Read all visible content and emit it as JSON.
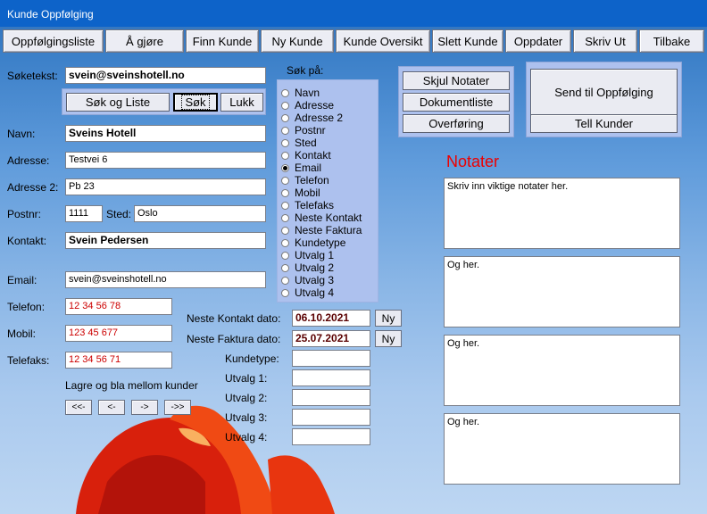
{
  "window": {
    "title": "Kunde Oppfølging"
  },
  "toolbar": [
    {
      "label": "Oppfølgingsliste"
    },
    {
      "label": "Å gjøre"
    },
    {
      "label": "Finn Kunde"
    },
    {
      "label": "Ny Kunde"
    },
    {
      "label": "Kunde Oversikt"
    },
    {
      "label": "Slett Kunde"
    },
    {
      "label": "Oppdater"
    },
    {
      "label": "Skriv Ut"
    },
    {
      "label": "Tilbake"
    }
  ],
  "search": {
    "label": "Søketekst:",
    "value": "svein@sveinshotell.no",
    "buttons": {
      "search_list": "Søk og Liste",
      "search": "Søk",
      "close": "Lukk"
    },
    "search_on_label": "Søk på:",
    "options": [
      "Navn",
      "Adresse",
      "Adresse 2",
      "Postnr",
      "Sted",
      "Kontakt",
      "Email",
      "Telefon",
      "Mobil",
      "Telefaks",
      "Neste Kontakt",
      "Neste Faktura",
      "Kundetype",
      "Utvalg 1",
      "Utvalg 2",
      "Utvalg 3",
      "Utvalg 4"
    ],
    "selected": "Email"
  },
  "customer": {
    "name_label": "Navn:",
    "name": "Sveins Hotell",
    "address_label": "Adresse:",
    "address": "Testvei 6",
    "address2_label": "Adresse 2:",
    "address2": "Pb 23",
    "postnr_label": "Postnr:",
    "postnr": "1111",
    "sted_label": "Sted:",
    "sted": "Oslo",
    "contact_label": "Kontakt:",
    "contact": "Svein Pedersen",
    "email_label": "Email:",
    "email": "svein@sveinshotell.no",
    "phone_label": "Telefon:",
    "phone": "12 34 56 78",
    "mobile_label": "Mobil:",
    "mobile": "123 45 677",
    "fax_label": "Telefaks:",
    "fax": "12 34 56 71"
  },
  "dates": {
    "next_contact_label": "Neste Kontakt dato:",
    "next_contact": "06.10.2021",
    "next_invoice_label": "Neste Faktura dato:",
    "next_invoice": "25.07.2021",
    "new_label": "Ny"
  },
  "extra": {
    "kundetype_label": "Kundetype:",
    "kundetype": "",
    "utvalg1_label": "Utvalg 1:",
    "utvalg1": "",
    "utvalg2_label": "Utvalg 2:",
    "utvalg2": "",
    "utvalg3_label": "Utvalg 3:",
    "utvalg3": "",
    "utvalg4_label": "Utvalg 4:",
    "utvalg4": ""
  },
  "navigation": {
    "label": "Lagre og bla mellom kunder",
    "first": "<<-",
    "prev": "<-",
    "next": "->",
    "last": "->>"
  },
  "actions": {
    "hide_notes": "Skjul Notater",
    "document_list": "Dokumentliste",
    "transfer": "Overføring",
    "send_followup": "Send til Oppfølging",
    "count_customers": "Tell Kunder"
  },
  "notes": {
    "title": "Notater",
    "title_color": "#ee0000",
    "items": [
      "Skriv inn viktige notater her.",
      "Og her.",
      "Og her.",
      "Og her."
    ]
  }
}
